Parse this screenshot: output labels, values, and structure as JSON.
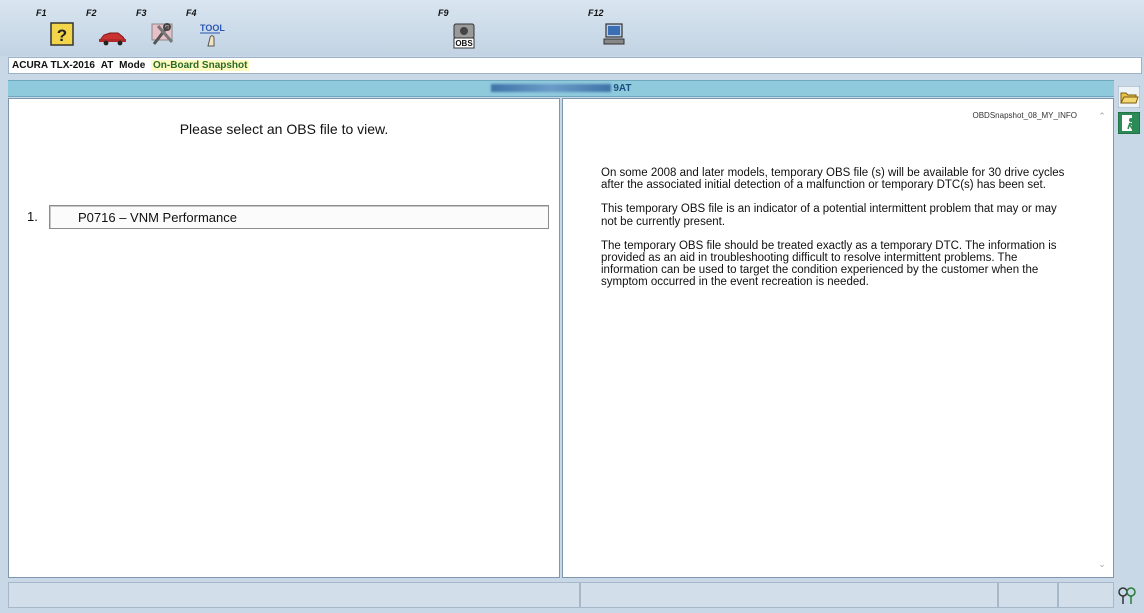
{
  "toolbar": {
    "keys": [
      {
        "label": "F1",
        "icon": "help-icon"
      },
      {
        "label": "F2",
        "icon": "car-icon"
      },
      {
        "label": "F3",
        "icon": "tools-icon"
      },
      {
        "label": "F4",
        "icon": "tool-touch-icon"
      },
      {
        "label": "F9",
        "icon": "obs-icon",
        "icon_text": "OBS"
      },
      {
        "label": "F12",
        "icon": "computer-icon"
      }
    ]
  },
  "info_bar": {
    "vehicle": "ACURA TLX-2016",
    "transmission": "AT",
    "mode_label": "Mode",
    "mode_value": "On-Board Snapshot"
  },
  "vin_bar": {
    "vin_suffix": "9AT"
  },
  "left_pane": {
    "title": "Please select an OBS file to view.",
    "files": [
      {
        "number": "1.",
        "label": "P0716 – VNM Performance"
      }
    ]
  },
  "right_pane": {
    "doc_name": "OBDSnapshot_08_MY_INFO",
    "paragraphs": [
      "On some 2008 and later models, temporary OBS file (s) will be available for 30 drive cycles after the associated initial detection of a malfunction or temporary DTC(s) has been set.",
      "This temporary OBS file is an indicator of a potential intermittent problem that may or may not be currently present.",
      "The temporary OBS file should be treated exactly as a temporary DTC. The information is provided as an aid in troubleshooting difficult to resolve intermittent problems. The information can be used to target the condition experienced by the customer when the symptom occurred in the event recreation is needed."
    ]
  },
  "colors": {
    "toolbar_bg": "#c9d8e6",
    "vin_bar_bg": "#8fc9dc",
    "mode_highlight": "#fffbc0"
  }
}
